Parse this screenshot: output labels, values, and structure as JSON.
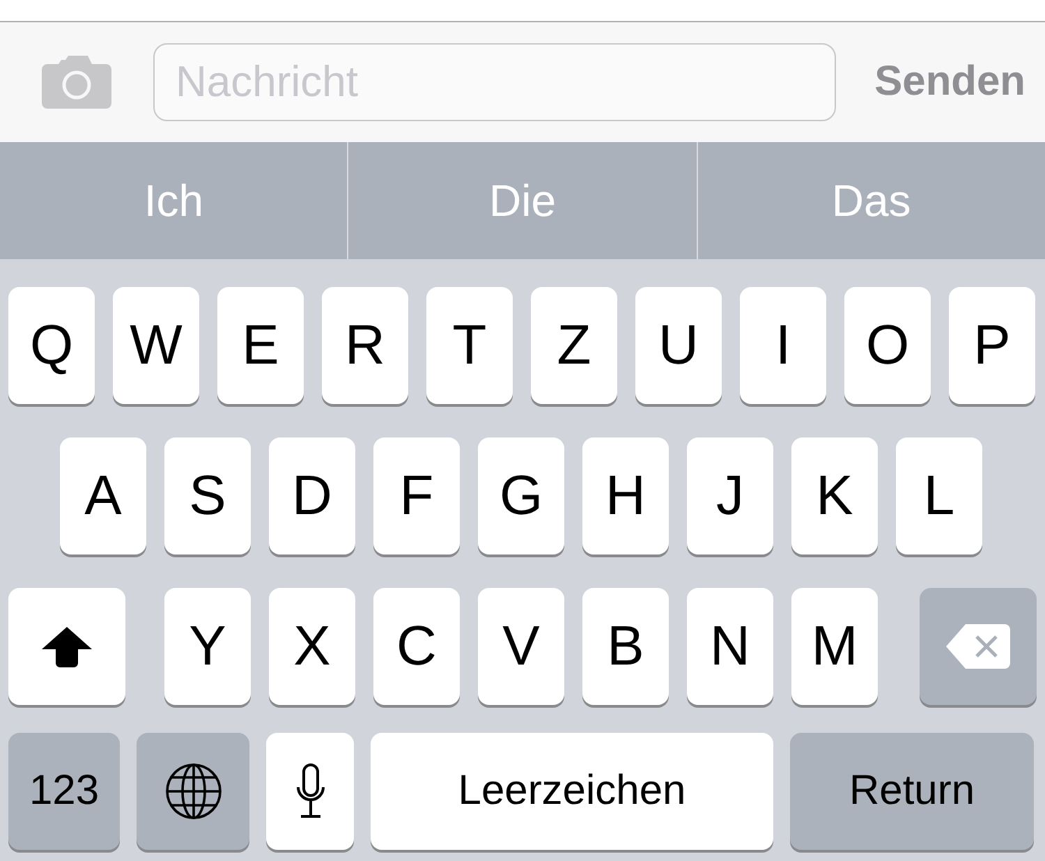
{
  "compose": {
    "placeholder": "Nachricht",
    "send": "Senden"
  },
  "suggestions": [
    "Ich",
    "Die",
    "Das"
  ],
  "keyboard": {
    "rows": [
      [
        {
          "kind": "letter",
          "label": "Q"
        },
        {
          "kind": "letter",
          "label": "W"
        },
        {
          "kind": "letter",
          "label": "E"
        },
        {
          "kind": "letter",
          "label": "R"
        },
        {
          "kind": "letter",
          "label": "T"
        },
        {
          "kind": "letter",
          "label": "Z"
        },
        {
          "kind": "letter",
          "label": "U"
        },
        {
          "kind": "letter",
          "label": "I"
        },
        {
          "kind": "letter",
          "label": "O"
        },
        {
          "kind": "letter",
          "label": "P"
        }
      ],
      [
        {
          "kind": "letter",
          "label": "A"
        },
        {
          "kind": "letter",
          "label": "S"
        },
        {
          "kind": "letter",
          "label": "D"
        },
        {
          "kind": "letter",
          "label": "F"
        },
        {
          "kind": "letter",
          "label": "G"
        },
        {
          "kind": "letter",
          "label": "H"
        },
        {
          "kind": "letter",
          "label": "J"
        },
        {
          "kind": "letter",
          "label": "K"
        },
        {
          "kind": "letter",
          "label": "L"
        }
      ],
      [
        {
          "kind": "shift"
        },
        {
          "kind": "letter",
          "label": "Y"
        },
        {
          "kind": "letter",
          "label": "X"
        },
        {
          "kind": "letter",
          "label": "C"
        },
        {
          "kind": "letter",
          "label": "V"
        },
        {
          "kind": "letter",
          "label": "B"
        },
        {
          "kind": "letter",
          "label": "N"
        },
        {
          "kind": "letter",
          "label": "M"
        },
        {
          "kind": "delete"
        }
      ]
    ],
    "bottom_row": {
      "numbers": "123",
      "space": "Leerzeichen",
      "return": "Return"
    }
  }
}
